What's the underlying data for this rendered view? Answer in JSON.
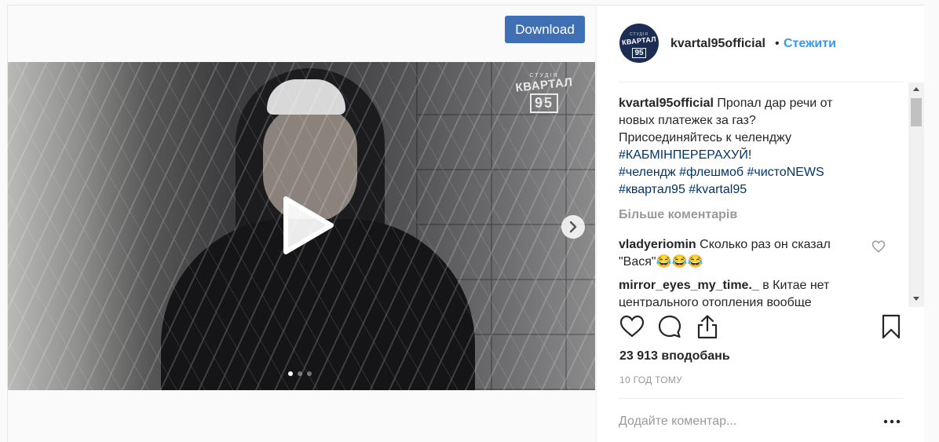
{
  "toolbar": {
    "download_label": "Download"
  },
  "media": {
    "logo": {
      "studio": "СТУДІЯ",
      "name": "КВАРТАЛ",
      "number": "95"
    },
    "carousel_dots": 3,
    "active_dot": 1
  },
  "header": {
    "avatar": {
      "studio": "СТУДІЯ",
      "name": "КВАРТАЛ",
      "number": "95"
    },
    "username": "kvartal95official",
    "separator": "•",
    "follow_label": "Стежити"
  },
  "caption": {
    "username": "kvartal95official",
    "lines": [
      "Пропал дар речи от",
      "новых платежек за газ?",
      "Присоединяйтесь к челенджу"
    ],
    "hashtag_main": "#КАБМІНПЕРЕРАХУЙ",
    "hashtag_main_suffix": "!",
    "hashtags_line1": [
      "#челендж",
      "#флешмоб",
      "#чистоNEWS"
    ],
    "hashtags_line2": [
      "#квартал95",
      "#kvartal95"
    ]
  },
  "more_comments_label": "Більше коментарів",
  "comments": [
    {
      "username": "vladyeriomin",
      "text_line1": "Сколько раз он сказал",
      "text_line2": "\"Вася\"😂😂😂"
    },
    {
      "username": "mirror_eyes_my_time._",
      "text_line1": "в Китае нет",
      "text_line2": "центрального отопления вообще"
    }
  ],
  "likes": "23 913 вподобань",
  "timestamp": "10 ГОД ТОМУ",
  "comment_input": {
    "placeholder": "Додайте коментар..."
  },
  "icons": {
    "like": "heart-icon",
    "comment": "comment-icon",
    "share": "share-icon",
    "save": "bookmark-icon",
    "play": "play-icon",
    "next": "chevron-right-icon",
    "options": "more-options-icon"
  }
}
